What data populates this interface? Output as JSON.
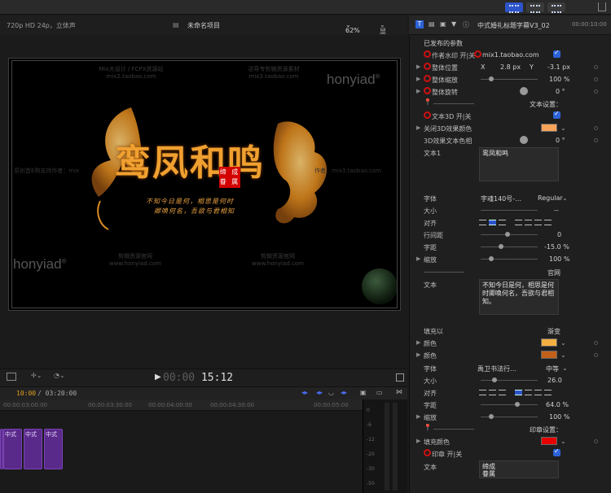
{
  "viewer": {
    "format": "720p HD 24p，立体声",
    "project_name": "未命名项目",
    "zoom": "62%",
    "display_label": "显示",
    "watermarks": {
      "top_left": "Mix大设计 / FCPX资源站",
      "top_left_sub": "mix2.taobao.com",
      "top_center": "达导专剪辑资源素材",
      "top_center_sub": "mix3.taobao.com",
      "brand": "honyiad",
      "brand_reg": "®",
      "mid_left": "原创首E购支持作者：mix",
      "mid_right": "作者：mix3.taobao.com",
      "bottom_center": "剪辑资源官网",
      "bottom_center_sub": "www.honyiad.com",
      "bottom_right": "剪辑资源官网",
      "bottom_right_sub": "www.honyiad.com"
    },
    "title_main": "鸾凤和鸣",
    "seal_text": "缔 成 眷 属",
    "poem_line1": "不知今日是何，相思是何时",
    "poem_line2": "卿唤何名，吾欲与君相知"
  },
  "transport": {
    "timecode_dim": "00:00",
    "timecode_main": "15:12"
  },
  "timeline": {
    "position": "10:00",
    "duration": "03:20:00",
    "ruler": [
      "00:00:03:00:00",
      "00:00:03:30:00",
      "00:00:04:00:00",
      "00:00:04:30:00",
      "00:00:05:00"
    ],
    "clip_label": "中式",
    "meter_scale": [
      "0",
      "-6",
      "-12",
      "-20",
      "-30",
      "-50"
    ]
  },
  "inspector": {
    "title": "中式婚礼标题字幕V3_02",
    "time": "00:00:10:00",
    "section": "已发布的参数",
    "author_label": "作者水印 开|关",
    "author_value": "mix1.taobao.com",
    "position_label": "整体位置",
    "position_x_label": "X",
    "position_x": "2.8 px",
    "position_y_label": "Y",
    "position_y": "-3.1 px",
    "scale_label": "整体缩放",
    "scale_value": "100 %",
    "rotation_label": "整体旋转",
    "rotation_value": "0 °",
    "text_settings": "文本设置：",
    "text3d_label": "文本3D 开|关",
    "close3d_color": "关闭3D效果颜色",
    "text3d_hue": "3D效果文本色相",
    "text3d_hue_value": "0 °",
    "text1_label": "文本1",
    "text1_value": "鸾凤和鸣",
    "font_label": "字体",
    "font1_value": "字魂140号-…",
    "font1_weight": "Regular",
    "size_label": "大小",
    "size1_value": "--",
    "align_label": "对齐",
    "linespacing_label": "行间距",
    "linespacing1_value": "0",
    "tracking_label": "字距",
    "tracking1_value": "-15.0 %",
    "scale2_label": "缩放",
    "scale2_value": "100 %",
    "official_label": "官网",
    "text_label": "文本",
    "text2_value": "不知今日是何，相思是何时卿唤何名，吾欲与君相知。",
    "fill_label": "填充以",
    "fill_value": "渐变",
    "color_label": "颜色",
    "font2_value": "禹卫书法行…",
    "font2_weight": "中等",
    "size2_value": "26.0",
    "tracking2_value": "64.0 %",
    "scale3_value": "100 %",
    "seal_settings": "印章设置：",
    "fill_color_label": "填充颜色",
    "seal_label": "印章 开|关",
    "seal_text_label": "文本",
    "seal_text_value": "缔成眷属",
    "colors": {
      "close3d": "#f7a35a",
      "color1": "#f5b042",
      "color2": "#c2601a",
      "fill": "#e60000"
    }
  }
}
